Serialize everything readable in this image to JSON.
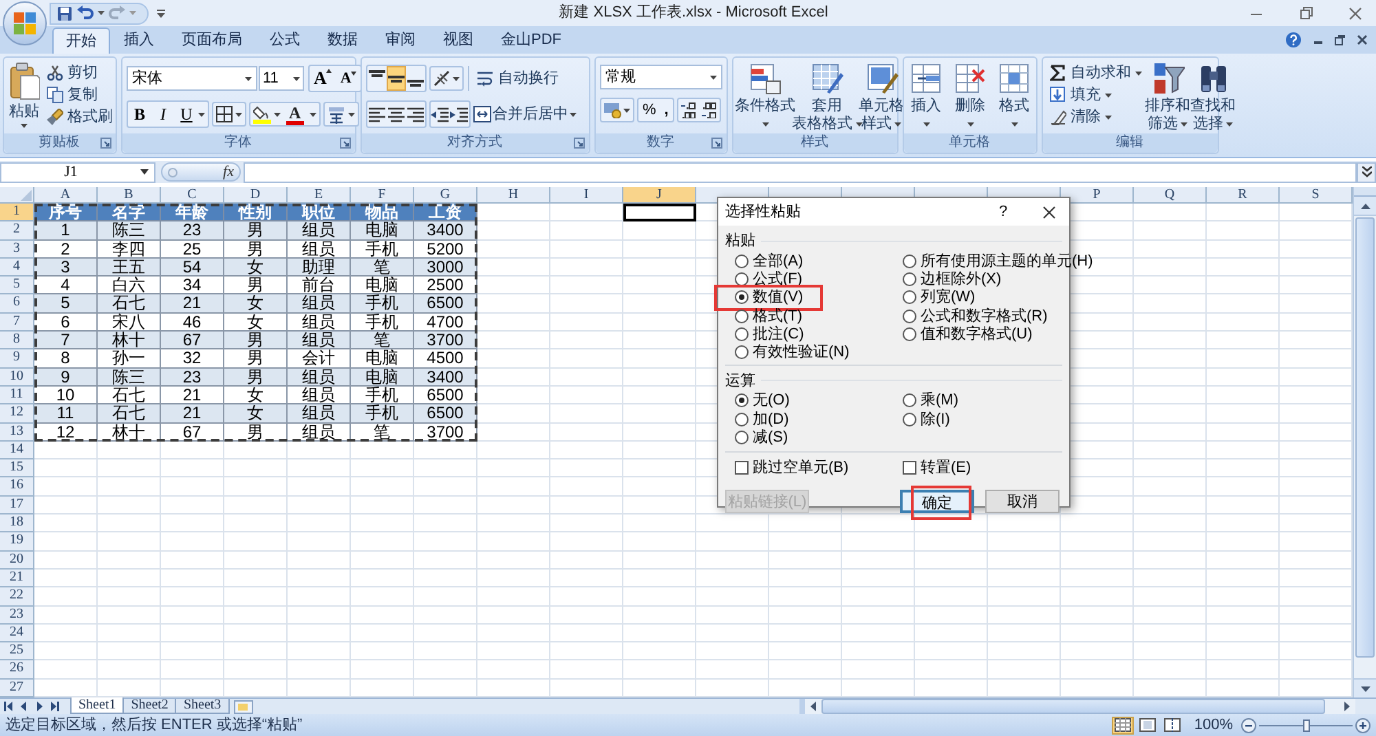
{
  "title_bar": {
    "title": "新建 XLSX 工作表.xlsx - Microsoft Excel"
  },
  "tabs": [
    {
      "label": "开始",
      "selected": true
    },
    {
      "label": "插入",
      "selected": false
    },
    {
      "label": "页面布局",
      "selected": false
    },
    {
      "label": "公式",
      "selected": false
    },
    {
      "label": "数据",
      "selected": false
    },
    {
      "label": "审阅",
      "selected": false
    },
    {
      "label": "视图",
      "selected": false
    },
    {
      "label": "金山PDF",
      "selected": false
    }
  ],
  "ribbon": {
    "clipboard": {
      "label": "剪贴板",
      "paste": "粘贴",
      "items": [
        "剪切",
        "复制",
        "格式刷"
      ]
    },
    "font": {
      "label": "字体",
      "font_name": "宋体",
      "font_size": "11",
      "grow": "A",
      "shrink": "A",
      "styles": [
        "B",
        "I",
        "U"
      ],
      "font_color": "A"
    },
    "alignment": {
      "label": "对齐方式",
      "wrap": "自动换行",
      "merge": "合并后居中",
      "vertical_align": [
        {
          "selected": false
        },
        {
          "selected": true
        },
        {
          "selected": false
        }
      ]
    },
    "number": {
      "label": "数字",
      "format": "常规",
      "percent": "%",
      "comma": ","
    },
    "styles": {
      "label": "样式",
      "buttons": [
        {
          "lines": [
            "条件格式"
          ],
          "caret_inline": false
        },
        {
          "lines": [
            "套用",
            "表格格式"
          ],
          "caret_inline": true
        },
        {
          "lines": [
            "单元格",
            "样式"
          ],
          "caret_inline": true
        }
      ]
    },
    "cells": {
      "label": "单元格",
      "buttons": [
        {
          "lines": [
            "插入"
          ],
          "caret_inline": false
        },
        {
          "lines": [
            "删除"
          ],
          "caret_inline": false
        },
        {
          "lines": [
            "格式"
          ],
          "caret_inline": false
        }
      ]
    },
    "editing": {
      "label": "编辑",
      "small": [
        "自动求和",
        "填充",
        "清除"
      ],
      "buttons": [
        {
          "lines": [
            "排序和",
            "筛选"
          ],
          "caret_inline": true
        },
        {
          "lines": [
            "查找和",
            "选择"
          ],
          "caret_inline": true
        }
      ]
    }
  },
  "formula_bar": {
    "name_box": "J1",
    "function_label": "fx"
  },
  "sheet": {
    "copied": true,
    "columns": [
      {
        "kind": "column",
        "letter": "A",
        "selected": false
      },
      {
        "kind": "column",
        "letter": "B",
        "selected": false
      },
      {
        "kind": "column",
        "letter": "C",
        "selected": false
      },
      {
        "kind": "column",
        "letter": "D",
        "selected": false
      },
      {
        "kind": "column",
        "letter": "E",
        "selected": false
      },
      {
        "kind": "column",
        "letter": "F",
        "selected": false
      },
      {
        "kind": "column",
        "letter": "G",
        "selected": false
      },
      {
        "kind": "column",
        "letter": "H",
        "selected": false
      },
      {
        "kind": "column",
        "letter": "I",
        "selected": false
      },
      {
        "kind": "column",
        "letter": "J",
        "selected": true
      },
      {
        "kind": "covered"
      },
      {
        "kind": "covered"
      },
      {
        "kind": "covered"
      },
      {
        "kind": "covered"
      },
      {
        "kind": "covered"
      },
      {
        "kind": "column",
        "letter": "P",
        "selected": false
      },
      {
        "kind": "column",
        "letter": "Q",
        "selected": false
      },
      {
        "kind": "column",
        "letter": "R",
        "selected": false
      },
      {
        "kind": "column",
        "letter": "S",
        "selected": false
      }
    ],
    "rows": [
      {
        "number": "1",
        "selected": true,
        "kind": "header",
        "cells": [
          "序号",
          "名字",
          "年龄",
          "性别",
          "职位",
          "物品",
          "工资"
        ]
      },
      {
        "number": "2",
        "selected": false,
        "kind": "data",
        "cells": [
          "1",
          "陈三",
          "23",
          "男",
          "组员",
          "电脑",
          "3400"
        ]
      },
      {
        "number": "3",
        "selected": false,
        "kind": "data",
        "cells": [
          "2",
          "李四",
          "25",
          "男",
          "组员",
          "手机",
          "5200"
        ]
      },
      {
        "number": "4",
        "selected": false,
        "kind": "data",
        "cells": [
          "3",
          "王五",
          "54",
          "女",
          "助理",
          "笔",
          "3000"
        ]
      },
      {
        "number": "5",
        "selected": false,
        "kind": "data",
        "cells": [
          "4",
          "白六",
          "34",
          "男",
          "前台",
          "电脑",
          "2500"
        ]
      },
      {
        "number": "6",
        "selected": false,
        "kind": "data",
        "cells": [
          "5",
          "石七",
          "21",
          "女",
          "组员",
          "手机",
          "6500"
        ]
      },
      {
        "number": "7",
        "selected": false,
        "kind": "data",
        "cells": [
          "6",
          "宋八",
          "46",
          "女",
          "组员",
          "手机",
          "4700"
        ]
      },
      {
        "number": "8",
        "selected": false,
        "kind": "data",
        "cells": [
          "7",
          "林十",
          "67",
          "男",
          "组员",
          "笔",
          "3700"
        ]
      },
      {
        "number": "9",
        "selected": false,
        "kind": "data",
        "cells": [
          "8",
          "孙一",
          "32",
          "男",
          "会计",
          "电脑",
          "4500"
        ]
      },
      {
        "number": "10",
        "selected": false,
        "kind": "data",
        "cells": [
          "9",
          "陈三",
          "23",
          "男",
          "组员",
          "电脑",
          "3400"
        ]
      },
      {
        "number": "11",
        "selected": false,
        "kind": "data",
        "cells": [
          "10",
          "石七",
          "21",
          "女",
          "组员",
          "手机",
          "6500"
        ]
      },
      {
        "number": "12",
        "selected": false,
        "kind": "data",
        "cells": [
          "11",
          "石七",
          "21",
          "女",
          "组员",
          "手机",
          "6500"
        ]
      },
      {
        "number": "13",
        "selected": false,
        "kind": "data",
        "cells": [
          "12",
          "林十",
          "67",
          "男",
          "组员",
          "笔",
          "3700"
        ]
      },
      {
        "number": "14",
        "selected": false
      },
      {
        "number": "15",
        "selected": false
      },
      {
        "number": "16",
        "selected": false
      },
      {
        "number": "17",
        "selected": false
      },
      {
        "number": "18",
        "selected": false
      },
      {
        "number": "19",
        "selected": false
      },
      {
        "number": "20",
        "selected": false
      },
      {
        "number": "21",
        "selected": false
      },
      {
        "number": "22",
        "selected": false
      },
      {
        "number": "23",
        "selected": false
      },
      {
        "number": "24",
        "selected": false
      },
      {
        "number": "25",
        "selected": false
      },
      {
        "number": "26",
        "selected": false
      },
      {
        "number": "27",
        "selected": false
      }
    ]
  },
  "dialog": {
    "title": "选择性粘贴",
    "help": "?",
    "sections": [
      {
        "label": "粘贴",
        "columns": [
          [
            {
              "label": "全部(A)",
              "selected": false,
              "marked": false
            },
            {
              "label": "公式(F)",
              "selected": false,
              "marked": false
            },
            {
              "label": "数值(V)",
              "selected": true,
              "marked": true
            },
            {
              "label": "格式(T)",
              "selected": false,
              "marked": false
            },
            {
              "label": "批注(C)",
              "selected": false,
              "marked": false
            },
            {
              "label": "有效性验证(N)",
              "selected": false,
              "marked": false
            }
          ],
          [
            {
              "label": "所有使用源主题的单元(H)",
              "selected": false,
              "marked": false
            },
            {
              "label": "边框除外(X)",
              "selected": false,
              "marked": false
            },
            {
              "label": "列宽(W)",
              "selected": false,
              "marked": false
            },
            {
              "label": "公式和数字格式(R)",
              "selected": false,
              "marked": false
            },
            {
              "label": "值和数字格式(U)",
              "selected": false,
              "marked": false
            }
          ]
        ]
      },
      {
        "label": "运算",
        "columns": [
          [
            {
              "label": "无(O)",
              "selected": true,
              "marked": false
            },
            {
              "label": "加(D)",
              "selected": false,
              "marked": false
            },
            {
              "label": "减(S)",
              "selected": false,
              "marked": false
            }
          ],
          [
            {
              "label": "乘(M)",
              "selected": false,
              "marked": false
            },
            {
              "label": "除(I)",
              "selected": false,
              "marked": false
            }
          ]
        ]
      }
    ],
    "checkboxes": [
      {
        "label": "跳过空单元(B)",
        "checked": false
      },
      {
        "label": "转置(E)",
        "checked": false
      }
    ],
    "buttons": [
      {
        "label": "粘贴链接(L)",
        "disabled": true,
        "default": false,
        "marked": false
      },
      {
        "label": "确定",
        "disabled": false,
        "default": true,
        "marked": true
      },
      {
        "label": "取消",
        "disabled": false,
        "default": false,
        "marked": false
      }
    ]
  },
  "sheet_tabs": [
    {
      "label": "Sheet1",
      "selected": true
    },
    {
      "label": "Sheet2",
      "selected": false
    },
    {
      "label": "Sheet3",
      "selected": false
    }
  ],
  "status_bar": {
    "message": "选定目标区域，然后按 ENTER 或选择“粘贴”",
    "views": [
      {
        "selected": true
      },
      {
        "selected": false
      },
      {
        "selected": false
      }
    ],
    "zoom": "100%",
    "zoom_slider": {
      "level": 0.5
    }
  }
}
